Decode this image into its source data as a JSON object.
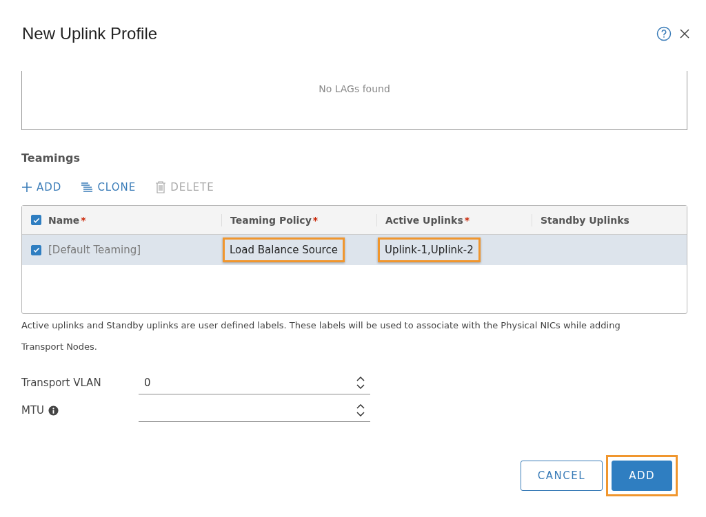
{
  "dialog": {
    "title": "New Uplink Profile"
  },
  "lags": {
    "empty_message": "No LAGs found"
  },
  "teamings": {
    "heading": "Teamings",
    "actions": [
      {
        "kind": "add",
        "label": "ADD",
        "disabled": false
      },
      {
        "kind": "clone",
        "label": "CLONE",
        "disabled": false
      },
      {
        "kind": "delete",
        "label": "DELETE",
        "disabled": true
      }
    ],
    "table": {
      "select_all": {
        "checked": true
      },
      "columns": [
        {
          "label": "Name",
          "required_mark": "*"
        },
        {
          "label": "Teaming Policy",
          "required_mark": "*"
        },
        {
          "label": "Active Uplinks",
          "required_mark": "*"
        },
        {
          "label": "Standby Uplinks"
        }
      ],
      "rows": [
        {
          "selected": true,
          "checked": true,
          "cells": [
            {
              "text": "[Default Teaming]",
              "muted": true,
              "highlighted": false
            },
            {
              "text": "Load Balance Source",
              "muted": false,
              "highlighted": true
            },
            {
              "text": "Uplink-1,Uplink-2",
              "muted": false,
              "highlighted": true
            }
          ]
        }
      ]
    }
  },
  "note": "Active uplinks and Standby uplinks are user defined labels. These labels will be used to associate with the Physical NICs while adding Transport Nodes.",
  "fields": [
    {
      "label": "Transport VLAN",
      "value": "0",
      "info": false
    },
    {
      "label": "MTU",
      "info": true
    }
  ],
  "buttons": [
    {
      "kind": "secondary",
      "label": "CANCEL",
      "highlighted": false
    },
    {
      "kind": "primary",
      "label": "ADD",
      "highlighted": true
    }
  ]
}
